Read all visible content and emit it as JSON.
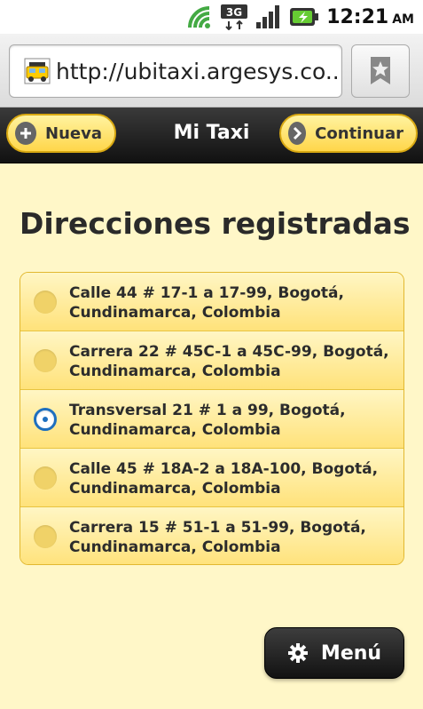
{
  "status_bar": {
    "time": "12:21",
    "ampm": "AM",
    "icons": [
      "wifi-icon",
      "3g-icon",
      "signal-icon",
      "battery-icon"
    ]
  },
  "browser": {
    "url": "http://ubitaxi.argesys.co...",
    "favicon": "taxi-icon",
    "bookmark_icon": "bookmark-star-icon"
  },
  "header": {
    "title": "Mi Taxi",
    "left_button": "Nueva",
    "right_button": "Continuar"
  },
  "main": {
    "heading": "Direcciones registradas",
    "addresses": [
      {
        "line1": "Calle 44 # 17-1 a 17-99, Bogotá,",
        "line2": "Cundinamarca, Colombia",
        "selected": false
      },
      {
        "line1": "Carrera 22 # 45C-1 a 45C-99, Bogotá,",
        "line2": "Cundinamarca, Colombia",
        "selected": false
      },
      {
        "line1": "Transversal 21 # 1 a 99, Bogotá,",
        "line2": "Cundinamarca, Colombia",
        "selected": true
      },
      {
        "line1": "Calle 45 # 18A-2 a 18A-100, Bogotá,",
        "line2": "Cundinamarca, Colombia",
        "selected": false
      },
      {
        "line1": "Carrera 15 # 51-1 a 51-99, Bogotá,",
        "line2": "Cundinamarca, Colombia",
        "selected": false
      }
    ]
  },
  "menu_button": {
    "label": "Menú",
    "icon": "gear-icon"
  },
  "colors": {
    "accent_yellow": "#ffd64a",
    "header_dark": "#1a1a1a",
    "radio_selected": "#1e6fbf",
    "page_bg": "#fff7c8"
  }
}
